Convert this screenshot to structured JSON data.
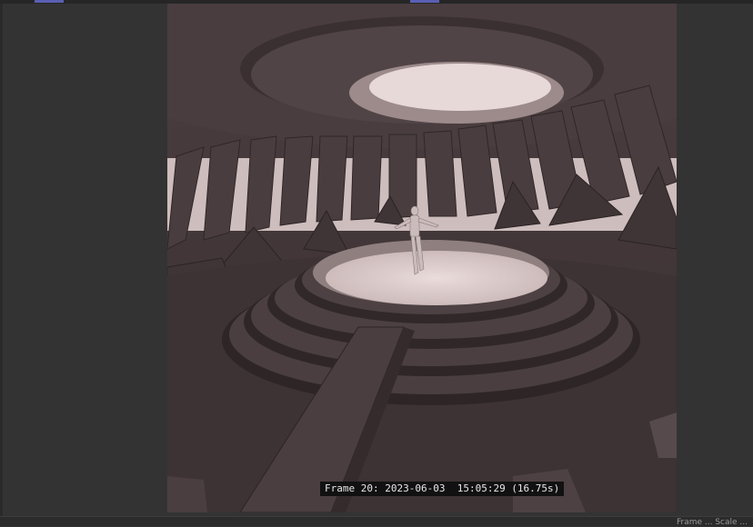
{
  "render": {
    "frame_label": "Frame 20:",
    "timestamp": "2023-06-03  15:05:29",
    "render_time": "(16.75s)"
  },
  "status_bar": {
    "text": "Frame ... Scale ..."
  },
  "colors": {
    "background": "#323232",
    "accent_tab": "#5a5fb4",
    "scene_dark": "#3b3133",
    "scene_light": "#d6c7c6"
  }
}
